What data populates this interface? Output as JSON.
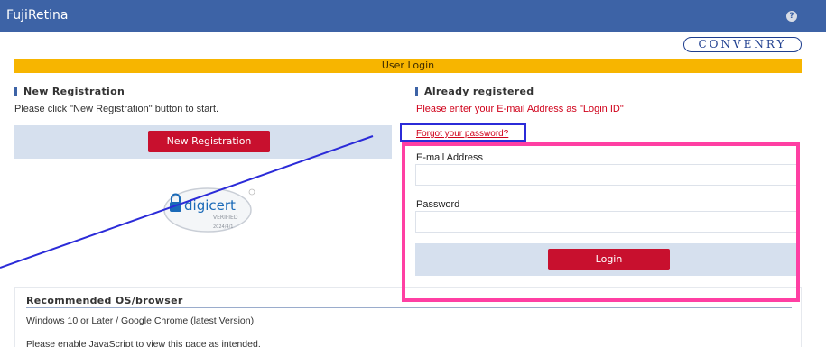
{
  "header": {
    "app_title": "FujiRetina",
    "help_icon": "question-circle-icon",
    "help_glyph": "?"
  },
  "brand": {
    "logo_text": "CONVENRY"
  },
  "login_bar": {
    "title": "User Login"
  },
  "new_registration": {
    "heading": "New Registration",
    "instruction": "Please click \"New Registration\" button to start.",
    "button_label": "New Registration"
  },
  "trust_seal": {
    "icon": "digicert-verified-seal-icon",
    "brand": "digicert",
    "status": "VERIFIED",
    "date": "2024/4/1"
  },
  "already_registered": {
    "heading": "Already registered",
    "instruction": "Please enter your E-mail Address as \"Login ID\"",
    "forgot_link": "Forgot your password?",
    "email_label": "E-mail Address",
    "email_value": "",
    "password_label": "Password",
    "password_value": "",
    "login_button": "Login"
  },
  "recommended": {
    "heading": "Recommended OS/browser",
    "line1": "Windows 10 or Later / Google Chrome (latest Version)",
    "line2": "Please enable JavaScript to view this page as intended."
  },
  "colors": {
    "header_bg": "#3d63a6",
    "bar_yellow": "#f7b500",
    "button_red": "#c8102e",
    "panel_blue": "#d6e0ee",
    "annotation_pink": "#ff3fa3",
    "annotation_blue": "#2b2bd8"
  }
}
